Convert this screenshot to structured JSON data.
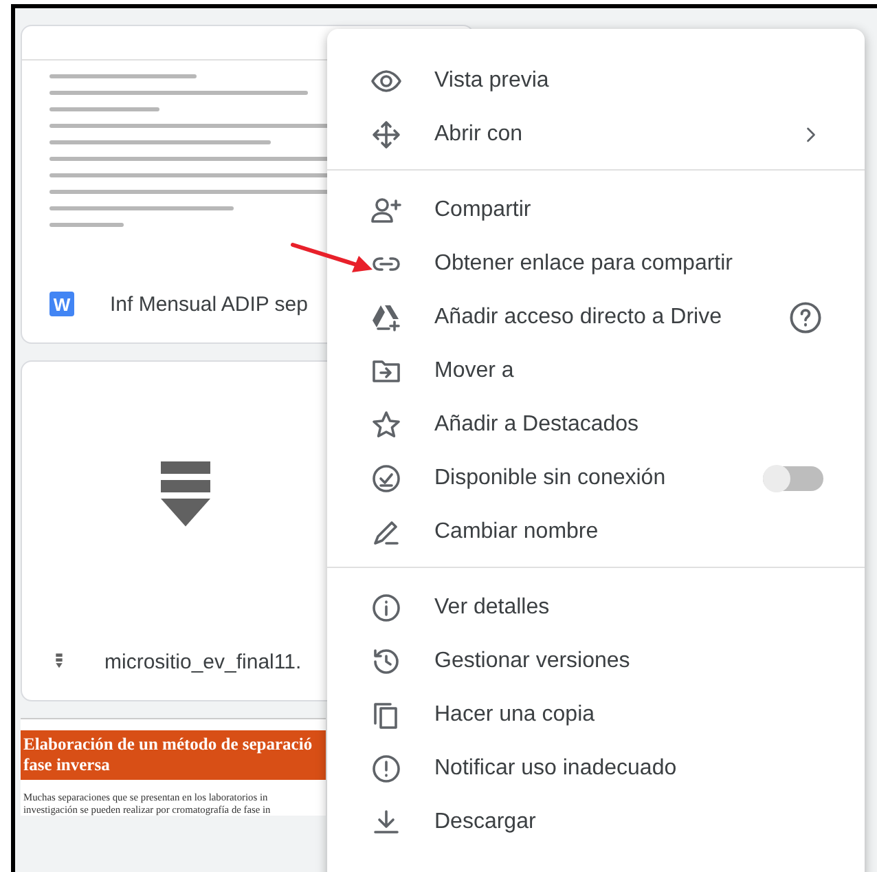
{
  "file_cards": [
    {
      "kind": "document",
      "title": "Inf Mensual ADIP sep",
      "icon_letter": "W"
    },
    {
      "kind": "archive",
      "title": "micrositio_ev_final11."
    }
  ],
  "article_preview": {
    "heading_lines": [
      "Elaboración de un método de separació",
      "fase inversa"
    ],
    "text_lines": [
      "Muchas separaciones que se presentan en los laboratorios in",
      "investigación se pueden realizar por cromatografía de fase in"
    ]
  },
  "menu": {
    "sections": [
      [
        {
          "label": "Vista previa",
          "kind": "plain"
        },
        {
          "label": "Abrir con",
          "kind": "submenu"
        }
      ],
      [
        {
          "label": "Compartir",
          "kind": "plain"
        },
        {
          "label": "Obtener enlace para compartir",
          "kind": "plain"
        },
        {
          "label": "Añadir acceso directo a Drive",
          "kind": "help"
        },
        {
          "label": "Mover a",
          "kind": "plain"
        },
        {
          "label": "Añadir a Destacados",
          "kind": "plain"
        },
        {
          "label": "Disponible sin conexión",
          "kind": "toggle",
          "on": false
        },
        {
          "label": "Cambiar nombre",
          "kind": "plain"
        }
      ],
      [
        {
          "label": "Ver detalles",
          "kind": "plain"
        },
        {
          "label": "Gestionar versiones",
          "kind": "plain"
        },
        {
          "label": "Hacer una copia",
          "kind": "plain"
        },
        {
          "label": "Notificar uso inadecuado",
          "kind": "plain"
        },
        {
          "label": "Descargar",
          "kind": "plain"
        }
      ]
    ]
  }
}
